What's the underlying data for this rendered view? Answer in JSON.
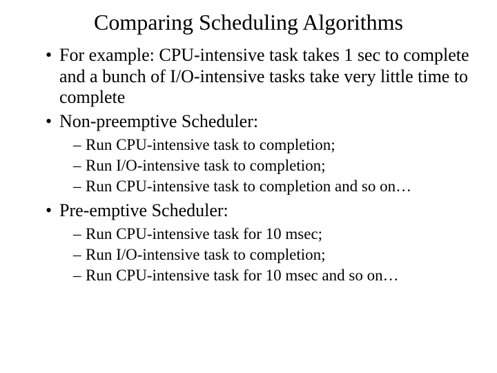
{
  "title": "Comparing Scheduling Algorithms",
  "bullets": {
    "b1": "For example: CPU-intensive task takes 1 sec to complete  and a bunch of I/O-intensive tasks take very little time to complete",
    "b2": "Non-preemptive Scheduler:",
    "b2_sub": {
      "s1": "Run CPU-intensive task to completion;",
      "s2": "Run I/O-intensive task to completion;",
      "s3": "Run CPU-intensive task to completion and so on…"
    },
    "b3": "Pre-emptive Scheduler:",
    "b3_sub": {
      "s1": "Run CPU-intensive task for 10 msec;",
      "s2": "Run I/O-intensive task to completion;",
      "s3": "Run CPU-intensive task for 10 msec and so on…"
    }
  }
}
